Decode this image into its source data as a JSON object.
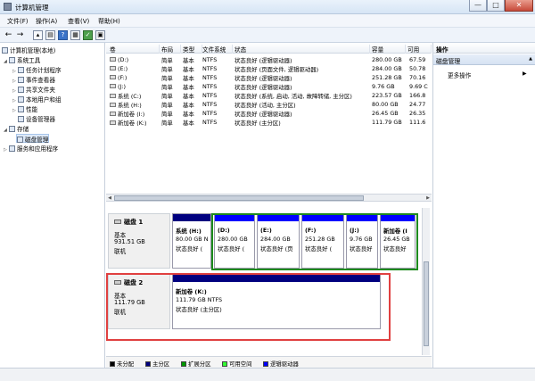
{
  "window": {
    "title": "计算机管理",
    "min": "—",
    "max": "□",
    "close": "✕"
  },
  "menu": [
    "文件(F)",
    "操作(A)",
    "查看(V)",
    "帮助(H)"
  ],
  "toolbar": {
    "back": "←",
    "forward": "→"
  },
  "tree": [
    {
      "label": "计算机管理(本地)",
      "arrow": "",
      "icon": "computer-icon"
    },
    {
      "label": "系统工具",
      "arrow": "◢",
      "icon": "tools-icon"
    },
    {
      "label": "任务计划程序",
      "arrow": "▷",
      "icon": "clock-icon"
    },
    {
      "label": "事件查看器",
      "arrow": "▷",
      "icon": "event-icon"
    },
    {
      "label": "共享文件夹",
      "arrow": "▷",
      "icon": "folder-icon"
    },
    {
      "label": "本地用户和组",
      "arrow": "▷",
      "icon": "users-icon"
    },
    {
      "label": "性能",
      "arrow": "▷",
      "icon": "performance-icon"
    },
    {
      "label": "设备管理器",
      "arrow": "",
      "icon": "device-icon"
    },
    {
      "label": "存储",
      "arrow": "◢",
      "icon": "storage-icon"
    },
    {
      "label": "磁盘管理",
      "arrow": "",
      "icon": "disk-icon"
    },
    {
      "label": "服务和应用程序",
      "arrow": "▷",
      "icon": "services-icon"
    }
  ],
  "volume_table": {
    "headers": [
      "卷",
      "布局",
      "类型",
      "文件系统",
      "状态",
      "容量",
      "可用"
    ],
    "rows": [
      [
        "(D:)",
        "简单",
        "基本",
        "NTFS",
        "状态良好 (逻辑驱动器)",
        "280.00 GB",
        "67.59"
      ],
      [
        "(E:)",
        "简单",
        "基本",
        "NTFS",
        "状态良好 (页面文件, 逻辑驱动器)",
        "284.00 GB",
        "50.78"
      ],
      [
        "(F:)",
        "简单",
        "基本",
        "NTFS",
        "状态良好 (逻辑驱动器)",
        "251.28 GB",
        "70.16"
      ],
      [
        "(J:)",
        "简单",
        "基本",
        "NTFS",
        "状态良好 (逻辑驱动器)",
        "9.76 GB",
        "9.69 C"
      ],
      [
        "系统 (C:)",
        "简单",
        "基本",
        "NTFS",
        "状态良好 (系统, 启动, 活动, 故障转储, 主分区)",
        "223.57 GB",
        "166.8"
      ],
      [
        "系统 (H:)",
        "简单",
        "基本",
        "NTFS",
        "状态良好 (活动, 主分区)",
        "80.00 GB",
        "24.77"
      ],
      [
        "新加卷 (I:)",
        "简单",
        "基本",
        "NTFS",
        "状态良好 (逻辑驱动器)",
        "26.45 GB",
        "26.35"
      ],
      [
        "新加卷 (K:)",
        "简单",
        "基本",
        "NTFS",
        "状态良好 (主分区)",
        "111.79 GB",
        "111.6"
      ]
    ]
  },
  "disks": [
    {
      "name": "磁盘 1",
      "type": "基本",
      "size": "931.51 GB",
      "status": "联机",
      "partitions": [
        {
          "name": "系统 (H:)",
          "size": "80.00 GB N",
          "status": "状态良好 (",
          "bar_color": "#00007f"
        },
        {
          "name": "(D:)",
          "size": "280.00 GB",
          "status": "状态良好 (",
          "bar_color": "#0000ff"
        },
        {
          "name": "(E:)",
          "size": "284.00 GB",
          "status": "状态良好 (页",
          "bar_color": "#0000ff"
        },
        {
          "name": "(F:)",
          "size": "251.28 GB",
          "status": "状态良好 (",
          "bar_color": "#0000ff"
        },
        {
          "name": "(J:)",
          "size": "9.76 GB",
          "status": "状态良好",
          "bar_color": "#0000ff"
        },
        {
          "name": "新加卷 (I",
          "size": "26.45 GB",
          "status": "状态良好",
          "bar_color": "#0000ff"
        }
      ]
    },
    {
      "name": "磁盘 2",
      "type": "基本",
      "size": "111.79 GB",
      "status": "联机",
      "partitions": [
        {
          "name": "新加卷 (K:)",
          "size": "111.79 GB NTFS",
          "status": "状态良好 (主分区)",
          "bar_color": "#00007f"
        }
      ]
    }
  ],
  "legend": [
    {
      "label": "未分配",
      "color": "#000000"
    },
    {
      "label": "主分区",
      "color": "#00007f"
    },
    {
      "label": "扩展分区",
      "color": "#009900"
    },
    {
      "label": "可用空间",
      "color": "#33ff33"
    },
    {
      "label": "逻辑驱动器",
      "color": "#0000ff"
    }
  ],
  "actions": {
    "header": "操作",
    "section": "磁盘管理",
    "more": "更多操作",
    "more_arrow": "▶",
    "section_arrow": "▲"
  },
  "colors": {
    "highlight_green": "#1d8a1d",
    "highlight_red": "#e04040"
  }
}
